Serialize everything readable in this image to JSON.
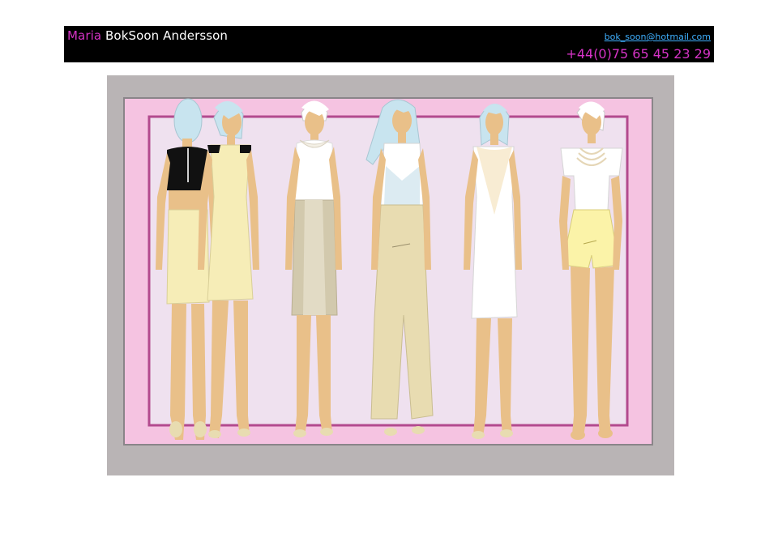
{
  "header": {
    "first_name": "Maria",
    "rest_name": " BokSoon Andersson",
    "email": "bok_soon@hotmail.com",
    "phone": "+44(0)75 65 45 23 29"
  },
  "artwork": {
    "figure_count": 6
  },
  "colors": {
    "header_bg": "#000000",
    "accent_magenta": "#d633c6",
    "link_blue": "#3fb0ff",
    "frame_grey": "#b9b4b5",
    "frame_pink": "#f5c3e1",
    "frame_line": "#b34a8e",
    "backdrop_lilac": "#efe1ef",
    "skin": "#e9c089",
    "hair": "#c8e4ef",
    "cream": "#f6edb7",
    "beige": "#e8dcb1",
    "white": "#ffffff",
    "black": "#111111",
    "yellow": "#fbf3a8",
    "taupe": "#d2c9ad"
  }
}
